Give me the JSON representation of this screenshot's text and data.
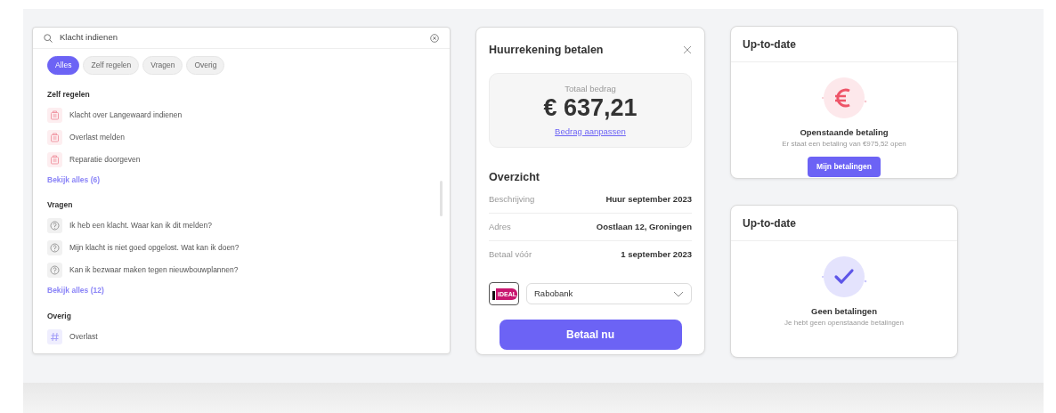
{
  "search": {
    "value": "Klacht indienen",
    "filters": [
      {
        "label": "Alles",
        "selected": true
      },
      {
        "label": "Zelf regelen",
        "selected": false
      },
      {
        "label": "Vragen",
        "selected": false
      },
      {
        "label": "Overig",
        "selected": false
      }
    ],
    "sections": [
      {
        "title": "Zelf regelen",
        "more": "Bekijk alles (6)",
        "items": [
          {
            "kind": "task",
            "text": "Klacht over Langewaard indienen"
          },
          {
            "kind": "task",
            "text": "Overlast melden"
          },
          {
            "kind": "task",
            "text": "Reparatie doorgeven"
          }
        ]
      },
      {
        "title": "Vragen",
        "more": "Bekijk alles (12)",
        "items": [
          {
            "kind": "question",
            "text": "Ik heb een klacht. Waar kan ik dit melden?"
          },
          {
            "kind": "question",
            "text": "Mijn klacht is niet goed opgelost. Wat kan ik doen?"
          },
          {
            "kind": "question",
            "text": "Kan ik bezwaar maken tegen nieuwbouwplannen?"
          }
        ]
      },
      {
        "title": "Overig",
        "items": [
          {
            "kind": "topic",
            "text": "Overlast"
          }
        ]
      }
    ]
  },
  "payment": {
    "title": "Huurrekening betalen",
    "total_label": "Totaal bedrag",
    "amount": "€ 637,21",
    "adjust_link": "Bedrag aanpassen",
    "overview_title": "Overzicht",
    "rows": [
      {
        "label": "Beschrijving",
        "value": "Huur september 2023"
      },
      {
        "label": "Adres",
        "value": "Oostlaan 12, Groningen"
      },
      {
        "label": "Betaal vóór",
        "value": "1 september 2023"
      }
    ],
    "bank_logo": "iDEAL",
    "bank": "Rabobank",
    "pay_button": "Betaal nu"
  },
  "status_cards": [
    {
      "title": "Up-to-date",
      "kind": "euro",
      "heading": "Openstaande betaling",
      "text": "Er staat een betaling van €975,52 open",
      "button": "Mijn betalingen"
    },
    {
      "title": "Up-to-date",
      "kind": "check",
      "heading": "Geen betalingen",
      "text": "Je hebt geen openstaande betalingen"
    }
  ]
}
